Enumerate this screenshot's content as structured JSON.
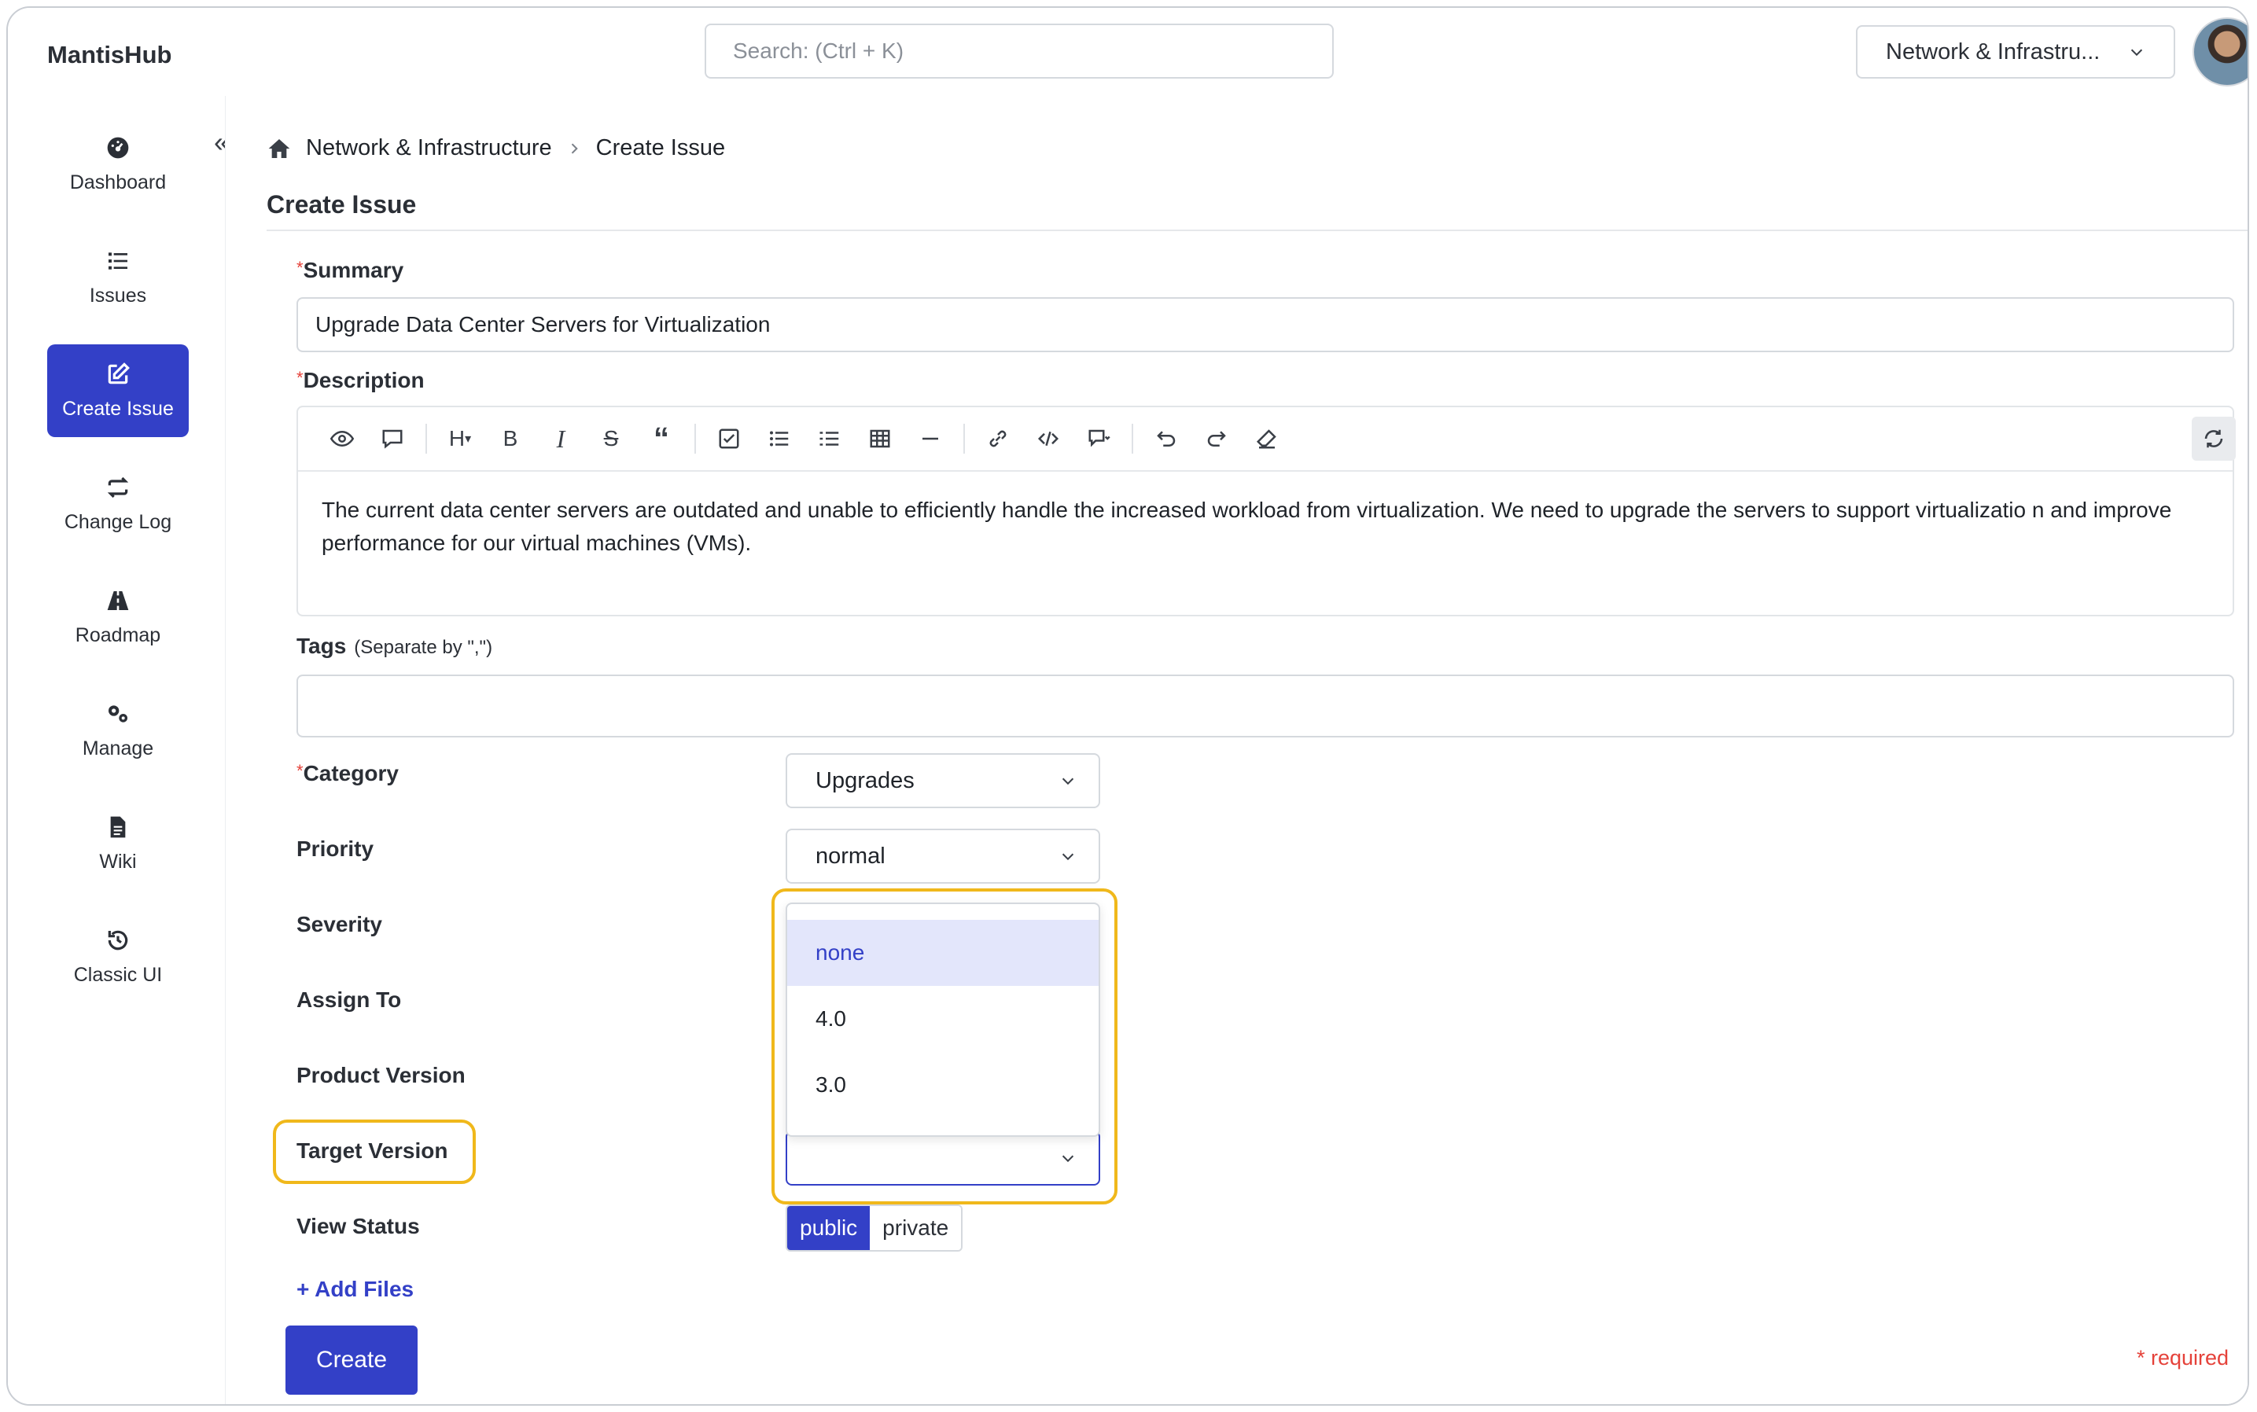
{
  "app": {
    "brand": "MantisHub",
    "search_placeholder": "Search: (Ctrl + K)",
    "project_selector": "Network & Infrastru..."
  },
  "sidebar": {
    "items": [
      {
        "label": "Dashboard",
        "icon": "dashboard-icon"
      },
      {
        "label": "Issues",
        "icon": "list-icon"
      },
      {
        "label": "Create Issue",
        "icon": "edit-icon",
        "active": true
      },
      {
        "label": "Change Log",
        "icon": "swap-icon"
      },
      {
        "label": "Roadmap",
        "icon": "road-icon"
      },
      {
        "label": "Manage",
        "icon": "gears-icon"
      },
      {
        "label": "Wiki",
        "icon": "file-icon"
      },
      {
        "label": "Classic UI",
        "icon": "history-icon"
      }
    ]
  },
  "breadcrumb": {
    "project": "Network & Infrastructure",
    "current": "Create Issue"
  },
  "page": {
    "title": "Create Issue"
  },
  "form": {
    "required_mark": "*",
    "summary_label": "Summary",
    "summary_value": "Upgrade Data Center Servers for Virtualization",
    "description_label": "Description",
    "description_text": "The current data center servers are outdated and unable to efficiently handle the increased workload from virtualization. We need to upgrade the servers to support virtualizatio n and improve performance for our virtual machines (VMs).",
    "tags_label": "Tags",
    "tags_hint": "(Separate by \",\")",
    "tags_value": "",
    "category_label": "Category",
    "category_value": "Upgrades",
    "priority_label": "Priority",
    "priority_value": "normal",
    "severity_label": "Severity",
    "assign_label": "Assign To",
    "product_version_label": "Product Version",
    "target_version_label": "Target Version",
    "target_version_value": "",
    "target_version_options": [
      "none",
      "4.0",
      "3.0"
    ],
    "target_version_highlighted": "none",
    "view_status_label": "View Status",
    "view_status_public": "public",
    "view_status_private": "private",
    "add_files": "+ Add Files",
    "create_button": "Create",
    "required_note": "* required"
  },
  "colors": {
    "accent": "#3340c7",
    "highlight": "#f0b81b",
    "required": "#e5423a",
    "dropdown_selected_bg": "#e3e6fb"
  }
}
